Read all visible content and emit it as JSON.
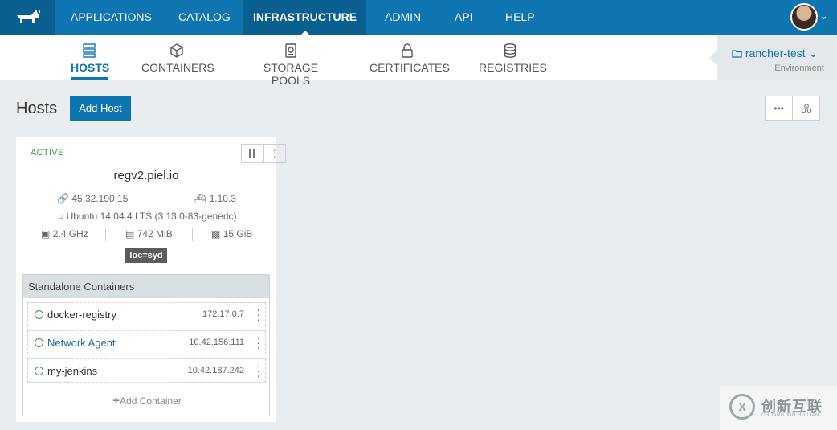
{
  "topnav": {
    "items": [
      {
        "label": "APPLICATIONS"
      },
      {
        "label": "CATALOG"
      },
      {
        "label": "INFRASTRUCTURE"
      },
      {
        "label": "ADMIN"
      },
      {
        "label": "API"
      },
      {
        "label": "HELP"
      }
    ],
    "active": "INFRASTRUCTURE"
  },
  "subnav": {
    "items": [
      {
        "label": "HOSTS",
        "icon": "hosts-icon"
      },
      {
        "label": "CONTAINERS",
        "icon": "cube-icon"
      },
      {
        "label": "STORAGE POOLS",
        "icon": "disk-icon"
      },
      {
        "label": "CERTIFICATES",
        "icon": "lock-icon"
      },
      {
        "label": "REGISTRIES",
        "icon": "database-icon"
      }
    ],
    "active": "HOSTS"
  },
  "environment": {
    "name": "rancher-test",
    "label": "Environment"
  },
  "page": {
    "title": "Hosts",
    "add_button": "Add Host"
  },
  "host": {
    "state": "ACTIVE",
    "hostname": "regv2.piel.io",
    "ip": "45.32.190.15",
    "docker_version": "1.10.3",
    "os": "Ubuntu 14.04.4 LTS (3.13.0-83-generic)",
    "cpu": "2.4 GHz",
    "memory": "742 MiB",
    "storage": "15 GiB",
    "label": "loc=syd",
    "containers_heading": "Standalone Containers",
    "containers": [
      {
        "name": "docker-registry",
        "ip": "172.17.0.7"
      },
      {
        "name": "Network Agent",
        "ip": "10.42.156.111"
      },
      {
        "name": "my-jenkins",
        "ip": "10.42.187.242"
      }
    ],
    "add_container": "Add Container"
  },
  "watermark": {
    "text": "创新互联",
    "sub": "CHUANG XIN HU LIAN"
  },
  "colors": {
    "brand": "#0e75b0",
    "brand_dark": "#0a5f91",
    "active_state": "#3a9b4a"
  }
}
